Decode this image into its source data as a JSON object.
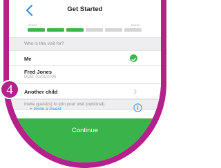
{
  "nav": {
    "title": "Get Started",
    "back_icon": "chevron-left-icon"
  },
  "progress": {
    "start_label": "START",
    "finish_label": "FINISH",
    "steps_completed": 3,
    "steps_total": 6
  },
  "who": {
    "header": "Who is this visit for?",
    "options": [
      {
        "title": "Me",
        "selected": true
      },
      {
        "title": "Fred Jones",
        "subtitle": "DOB: 01/01/2006"
      },
      {
        "title": "Another child"
      }
    ]
  },
  "guests": {
    "header": "Invite guest(s) to join your visit (optional).",
    "invite_link": "+ Invite a Guest",
    "info_icon": "info-icon"
  },
  "footer": {
    "continue_label": "Continue"
  },
  "badge": {
    "number": "4"
  },
  "colors": {
    "accent": "#3db54a",
    "link": "#3b8fd9",
    "frame": "#b5218b"
  }
}
